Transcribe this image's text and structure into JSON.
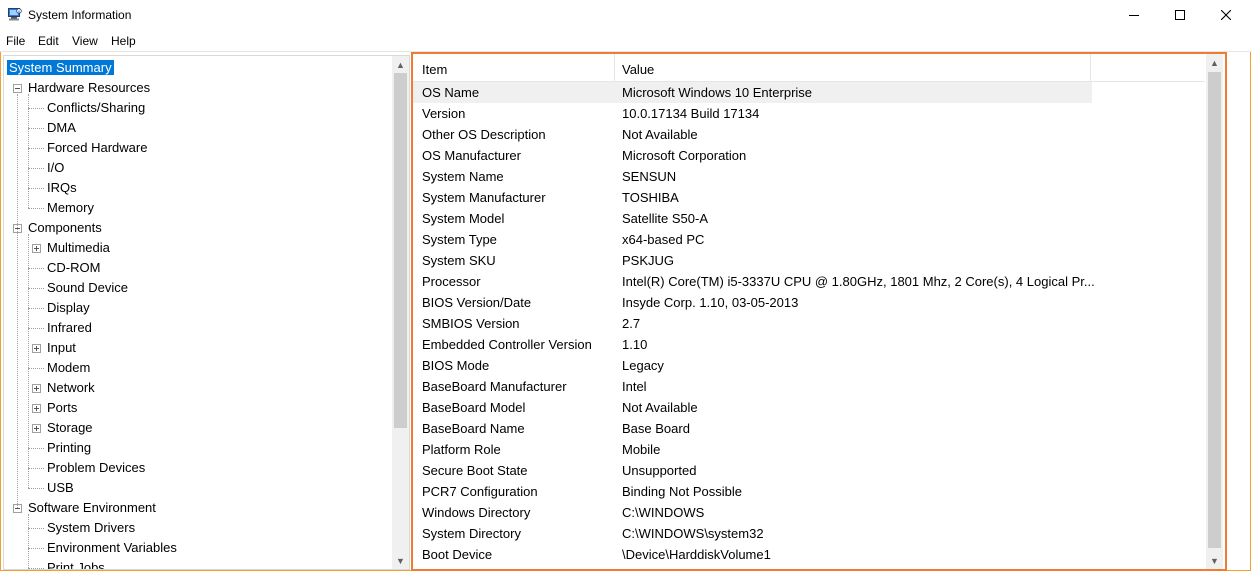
{
  "window": {
    "title": "System Information",
    "accent_border": "#f0a030"
  },
  "menu": [
    "File",
    "Edit",
    "View",
    "Help"
  ],
  "tree": [
    {
      "label": "System Summary",
      "level": 0,
      "expander": "none",
      "selected": true
    },
    {
      "label": "Hardware Resources",
      "level": 0,
      "expander": "minus"
    },
    {
      "label": "Conflicts/Sharing",
      "level": 1,
      "expander": "none"
    },
    {
      "label": "DMA",
      "level": 1,
      "expander": "none"
    },
    {
      "label": "Forced Hardware",
      "level": 1,
      "expander": "none"
    },
    {
      "label": "I/O",
      "level": 1,
      "expander": "none"
    },
    {
      "label": "IRQs",
      "level": 1,
      "expander": "none"
    },
    {
      "label": "Memory",
      "level": 1,
      "expander": "none"
    },
    {
      "label": "Components",
      "level": 0,
      "expander": "minus"
    },
    {
      "label": "Multimedia",
      "level": 1,
      "expander": "plus"
    },
    {
      "label": "CD-ROM",
      "level": 1,
      "expander": "none"
    },
    {
      "label": "Sound Device",
      "level": 1,
      "expander": "none"
    },
    {
      "label": "Display",
      "level": 1,
      "expander": "none"
    },
    {
      "label": "Infrared",
      "level": 1,
      "expander": "none"
    },
    {
      "label": "Input",
      "level": 1,
      "expander": "plus"
    },
    {
      "label": "Modem",
      "level": 1,
      "expander": "none"
    },
    {
      "label": "Network",
      "level": 1,
      "expander": "plus"
    },
    {
      "label": "Ports",
      "level": 1,
      "expander": "plus"
    },
    {
      "label": "Storage",
      "level": 1,
      "expander": "plus"
    },
    {
      "label": "Printing",
      "level": 1,
      "expander": "none"
    },
    {
      "label": "Problem Devices",
      "level": 1,
      "expander": "none"
    },
    {
      "label": "USB",
      "level": 1,
      "expander": "none"
    },
    {
      "label": "Software Environment",
      "level": 0,
      "expander": "minus"
    },
    {
      "label": "System Drivers",
      "level": 1,
      "expander": "none"
    },
    {
      "label": "Environment Variables",
      "level": 1,
      "expander": "none"
    },
    {
      "label": "Print Jobs",
      "level": 1,
      "expander": "none"
    }
  ],
  "details": {
    "columns": [
      "Item",
      "Value"
    ],
    "rows": [
      [
        "OS Name",
        "Microsoft Windows 10 Enterprise"
      ],
      [
        "Version",
        "10.0.17134 Build 17134"
      ],
      [
        "Other OS Description",
        "Not Available"
      ],
      [
        "OS Manufacturer",
        "Microsoft Corporation"
      ],
      [
        "System Name",
        "SENSUN"
      ],
      [
        "System Manufacturer",
        "TOSHIBA"
      ],
      [
        "System Model",
        "Satellite S50-A"
      ],
      [
        "System Type",
        "x64-based PC"
      ],
      [
        "System SKU",
        "PSKJUG"
      ],
      [
        "Processor",
        "Intel(R) Core(TM) i5-3337U CPU @ 1.80GHz, 1801 Mhz, 2 Core(s), 4 Logical Pr..."
      ],
      [
        "BIOS Version/Date",
        "Insyde Corp. 1.10, 03-05-2013"
      ],
      [
        "SMBIOS Version",
        "2.7"
      ],
      [
        "Embedded Controller Version",
        "1.10"
      ],
      [
        "BIOS Mode",
        "Legacy"
      ],
      [
        "BaseBoard Manufacturer",
        "Intel"
      ],
      [
        "BaseBoard Model",
        "Not Available"
      ],
      [
        "BaseBoard Name",
        "Base Board"
      ],
      [
        "Platform Role",
        "Mobile"
      ],
      [
        "Secure Boot State",
        "Unsupported"
      ],
      [
        "PCR7 Configuration",
        "Binding Not Possible"
      ],
      [
        "Windows Directory",
        "C:\\WINDOWS"
      ],
      [
        "System Directory",
        "C:\\WINDOWS\\system32"
      ],
      [
        "Boot Device",
        "\\Device\\HarddiskVolume1"
      ]
    ],
    "highlight_border": "#ed7d31"
  },
  "icons": {
    "app": "system-info-icon",
    "minimize": "minimize-icon",
    "maximize": "maximize-icon",
    "close": "close-icon"
  }
}
